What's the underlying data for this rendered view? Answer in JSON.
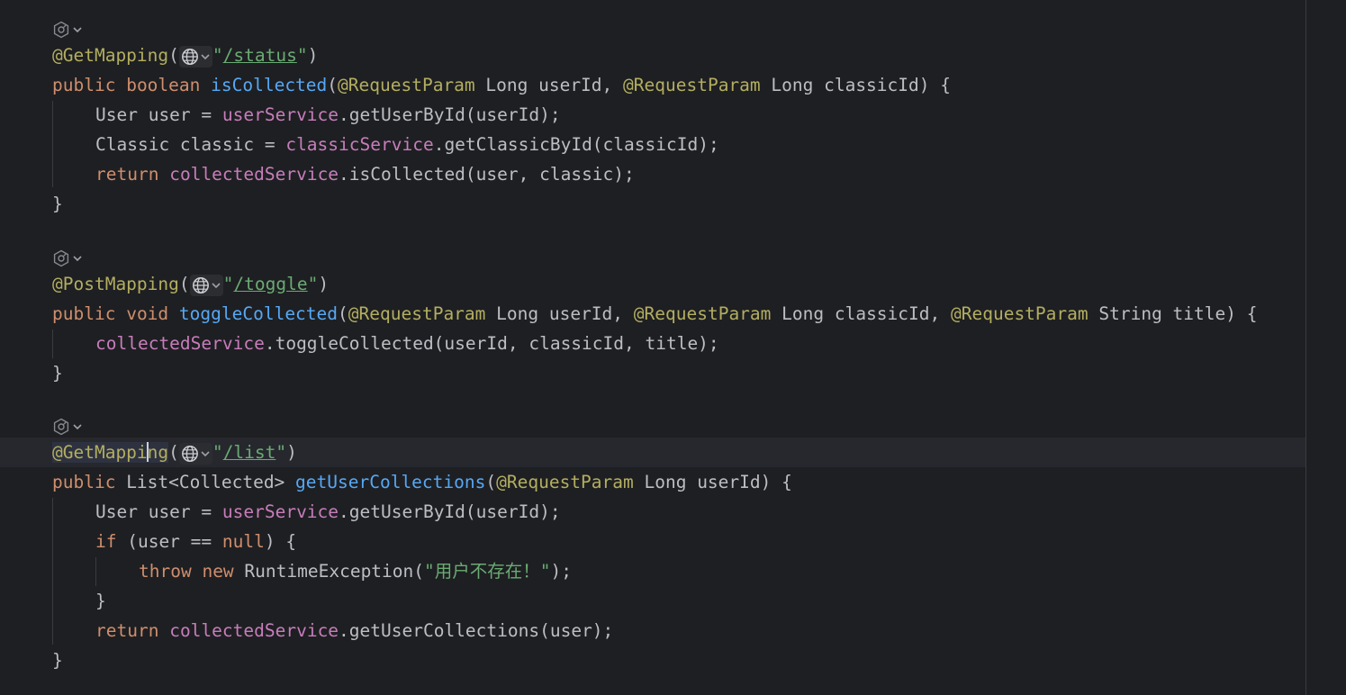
{
  "colors": {
    "background": "#1e1f22",
    "keyword": "#cf8e6d",
    "function": "#56a8f5",
    "annotation": "#b3ae60",
    "field": "#c77dbb",
    "string": "#6aab73",
    "text": "#bcbec4"
  },
  "icons": {
    "gutter": "spring-bean-icon",
    "dropdown": "chevron-down-icon",
    "web": "globe-icon"
  },
  "code": {
    "b1": {
      "annotation": "@GetMapping",
      "path": "/status",
      "kw_public": "public",
      "kw_type": "boolean",
      "method": "isCollected",
      "param_ann1": "@RequestParam",
      "param_mid": " Long userId, ",
      "param_ann2": "@RequestParam",
      "param_end": " Long classicId) {",
      "l1_pre": "User user = ",
      "l1_field": "userService",
      "l1_post": ".getUserById(userId);",
      "l2_pre": "Classic classic = ",
      "l2_field": "classicService",
      "l2_post": ".getClassicById(classicId);",
      "l3_kw": "return",
      "l3_field": "collectedService",
      "l3_post": ".isCollected(user, classic);",
      "close": "}"
    },
    "b2": {
      "annotation": "@PostMapping",
      "path": "/toggle",
      "kw_public": "public",
      "kw_type": "void",
      "method": "toggleCollected",
      "param_ann1": "@RequestParam",
      "param_mid1": " Long userId, ",
      "param_ann2": "@RequestParam",
      "param_mid2": " Long classicId, ",
      "param_ann3": "@RequestParam",
      "param_end": " String title) {",
      "l1_field": "collectedService",
      "l1_post": ".toggleCollected(userId, classicId, title);",
      "close": "}"
    },
    "b3": {
      "annotation_a": "@GetMappi",
      "annotation_b": "ng",
      "path": "/list",
      "kw_public": "public",
      "ret_type": " List<Collected> ",
      "method": "getUserCollections",
      "param_ann1": "@RequestParam",
      "param_end": " Long userId) {",
      "l1_pre": "User user = ",
      "l1_field": "userService",
      "l1_post": ".getUserById(userId);",
      "l2_kw": "if",
      "l2_mid": " (user == ",
      "l2_null": "null",
      "l2_end": ") {",
      "l3_kw1": "throw",
      "l3_kw2": "new",
      "l3_mid": " RuntimeException(",
      "l3_str": "\"用户不存在！\"",
      "l3_end": ");",
      "l4": "}",
      "l5_kw": "return",
      "l5_field": "collectedService",
      "l5_post": ".getUserCollections(user);",
      "close": "}"
    }
  }
}
